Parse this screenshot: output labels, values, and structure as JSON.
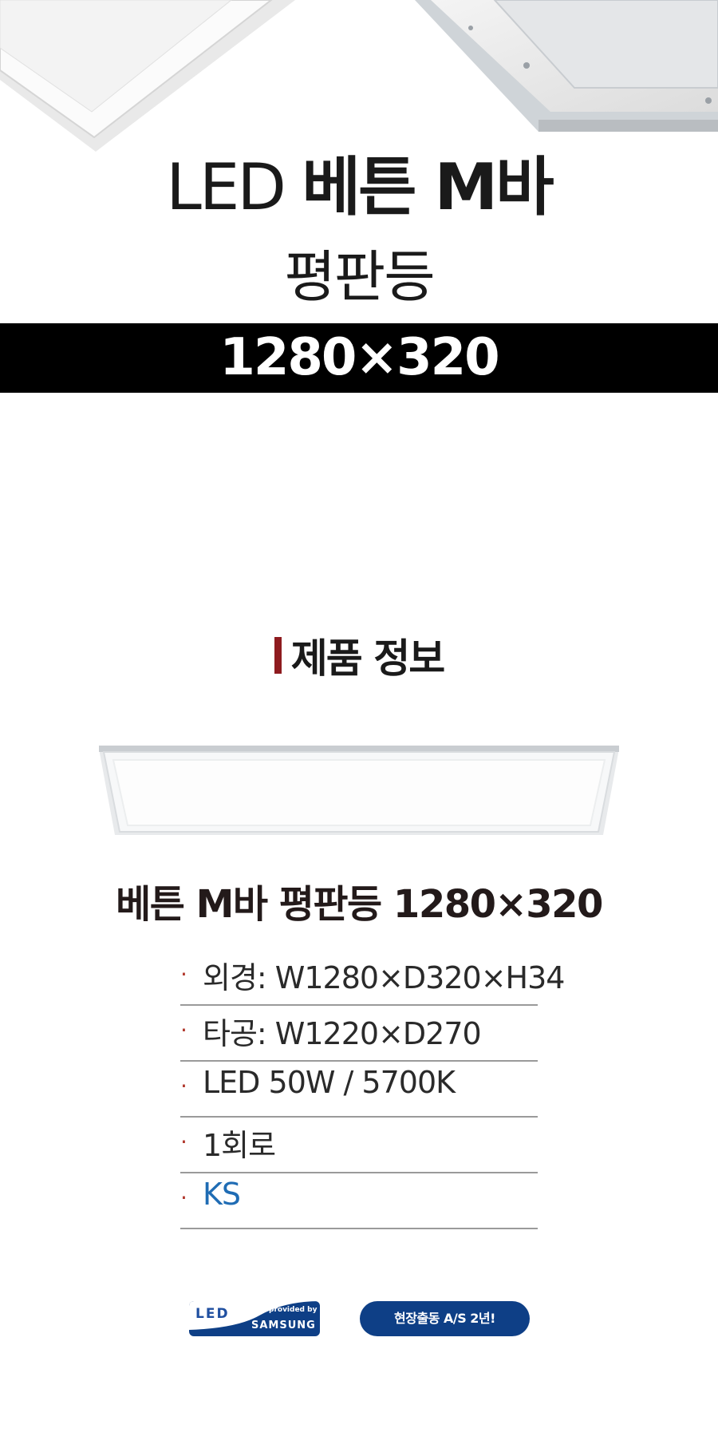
{
  "hero": {
    "title_light": "LED",
    "title_bold": "베튼 M바",
    "subtitle": "평판등",
    "size": "1280×320"
  },
  "product_info": {
    "heading": "제품 정보",
    "name": "베튼 M바 평판등 1280×320",
    "specs": [
      "외경: W1280×D320×H34",
      "타공: W1220×D270",
      "LED 50W  /  5700K",
      "1회로",
      "KS"
    ]
  },
  "badges": {
    "led_logo": "LED",
    "provided_by": "provided by",
    "samsung": "SAMSUNG",
    "warranty": "현장출동 A/S 2년!"
  },
  "colors": {
    "accent_bar": "#8e1b1f",
    "ks_blue": "#1f6cb4",
    "badge_navy": "#0e3f86"
  }
}
